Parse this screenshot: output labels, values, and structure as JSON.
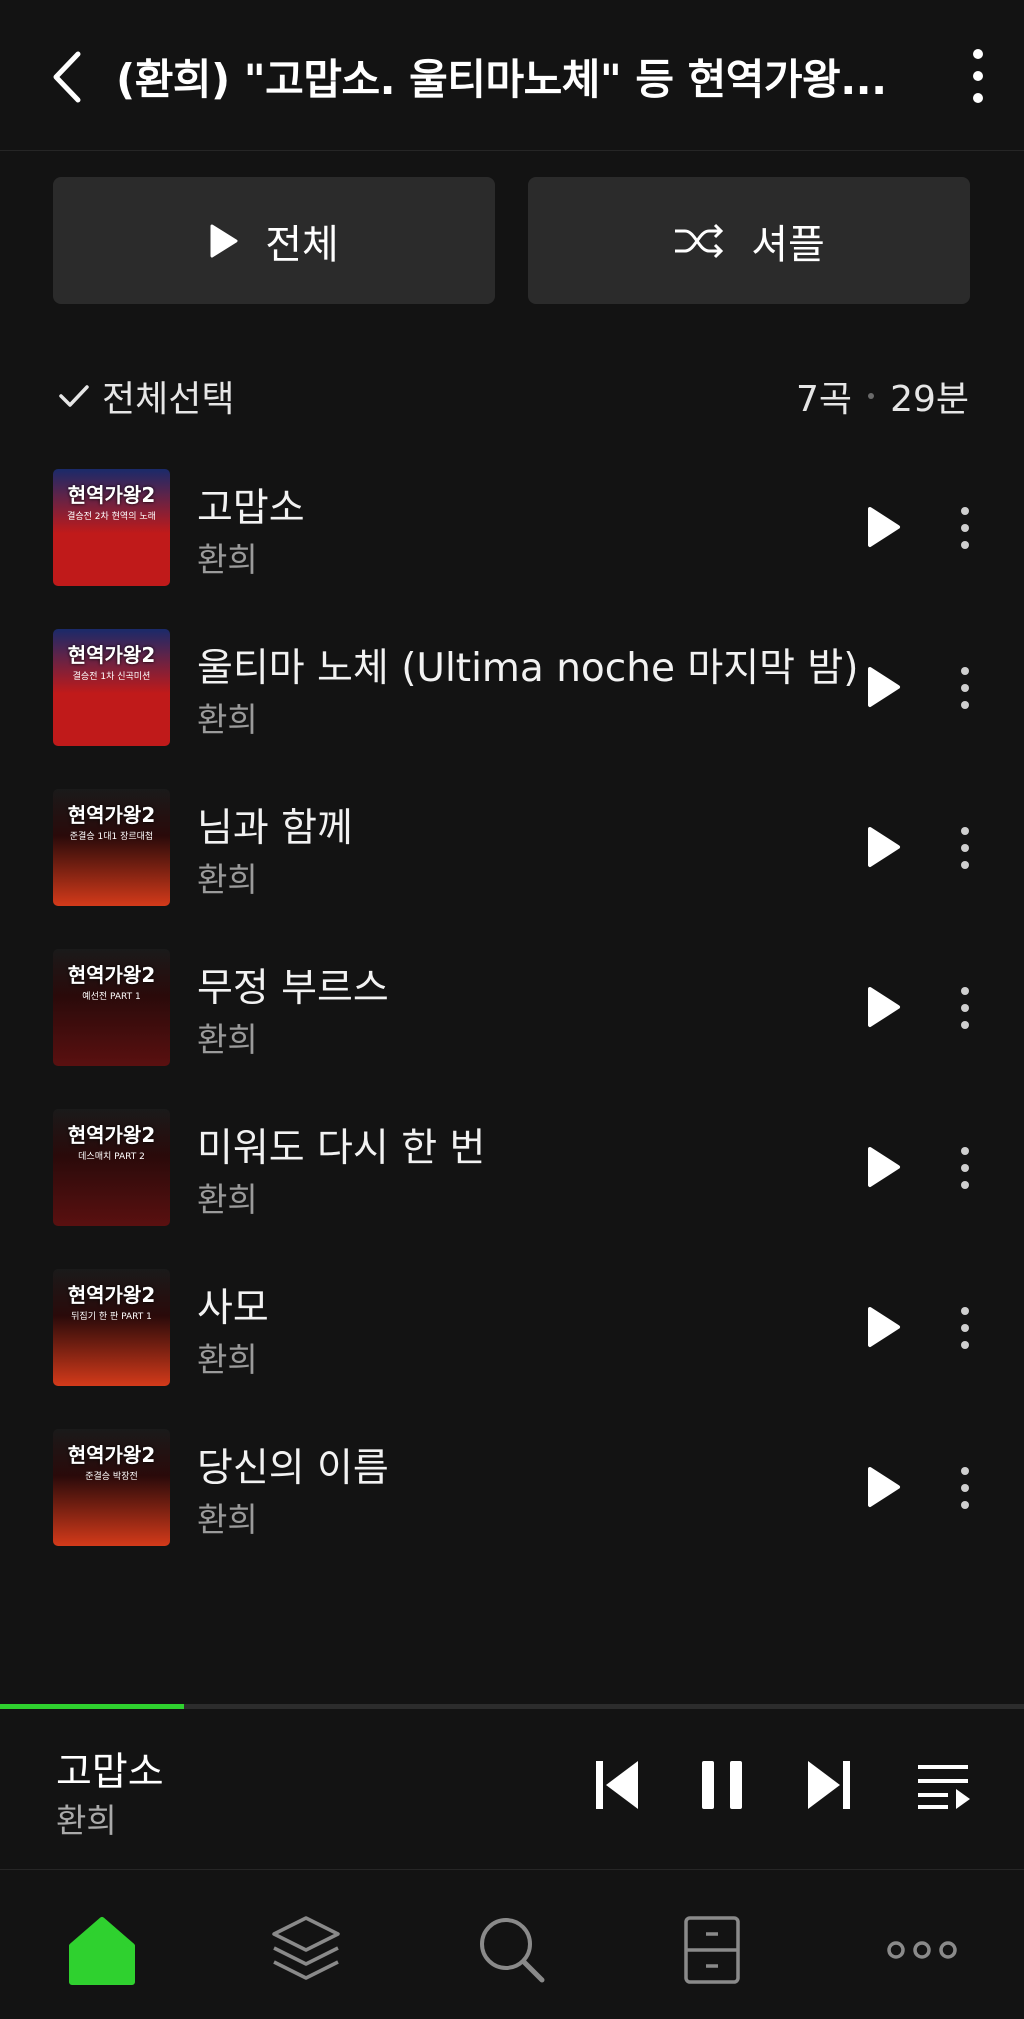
{
  "header": {
    "title": "(환희) \"고맙소. 울티마노체\" 등 현역가왕..."
  },
  "actions": {
    "play_all_label": "전체",
    "shuffle_label": "셔플"
  },
  "toolbar": {
    "select_all_label": "전체선택",
    "song_count": "7곡",
    "duration": "29분"
  },
  "tracks": [
    {
      "title": "고맙소",
      "artist": "환희",
      "cover_subtitle": "결승전 2차 현역의 노래",
      "cover_color": "#c01a1a"
    },
    {
      "title": "울티마 노체 (Ultima noche 마지막 밤)",
      "artist": "환희",
      "cover_subtitle": "결승전 1차 신곡미션",
      "cover_color": "#c01a1a"
    },
    {
      "title": "님과 함께",
      "artist": "환희",
      "cover_subtitle": "준결승 1대1 장르대첩",
      "cover_color": "#d43a1a"
    },
    {
      "title": "무정 부르스",
      "artist": "환희",
      "cover_subtitle": "예선전 PART 1",
      "cover_color": "#5a1010"
    },
    {
      "title": "미워도 다시 한 번",
      "artist": "환희",
      "cover_subtitle": "데스매치 PART 2",
      "cover_color": "#5a1010"
    },
    {
      "title": "사모",
      "artist": "환희",
      "cover_subtitle": "뒤집기 한 판 PART 1",
      "cover_color": "#d43a1a"
    },
    {
      "title": "당신의 이름",
      "artist": "환희",
      "cover_subtitle": "준결승 박장전",
      "cover_color": "#d43a1a"
    }
  ],
  "cover_logo": "현역가왕2",
  "player": {
    "title": "고맙소",
    "artist": "환희",
    "progress_fraction": 0.18
  },
  "colors": {
    "accent": "#2fd12f",
    "background": "#131313",
    "button": "#2b2b2b"
  },
  "nav": [
    "home-icon",
    "library-icon",
    "search-icon",
    "storage-icon",
    "more-icon"
  ]
}
